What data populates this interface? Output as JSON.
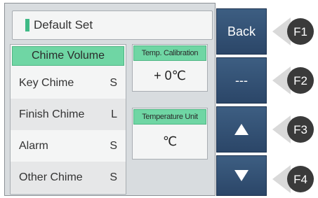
{
  "title": "Default Set",
  "chime_panel": {
    "header": "Chime Volume",
    "rows": [
      {
        "label": "Key Chime",
        "value": "S"
      },
      {
        "label": "Finish Chime",
        "value": "L"
      },
      {
        "label": "Alarm",
        "value": "S"
      },
      {
        "label": "Other Chime",
        "value": "S"
      }
    ]
  },
  "temp_calibration": {
    "header": "Temp. Calibration",
    "value": "+ 0℃"
  },
  "temp_unit": {
    "header": "Temperature Unit",
    "value": "℃"
  },
  "side_buttons": [
    {
      "label": "Back",
      "icon": ""
    },
    {
      "label": "---",
      "icon": ""
    },
    {
      "label": "",
      "icon": "up-triangle-icon"
    },
    {
      "label": "",
      "icon": "down-triangle-icon"
    }
  ],
  "function_keys": [
    "F1",
    "F2",
    "F3",
    "F4"
  ],
  "colors": {
    "accent_green": "#6fd6a4",
    "button_blue": "#33507a",
    "fkey_dark": "#3a3a3a"
  }
}
